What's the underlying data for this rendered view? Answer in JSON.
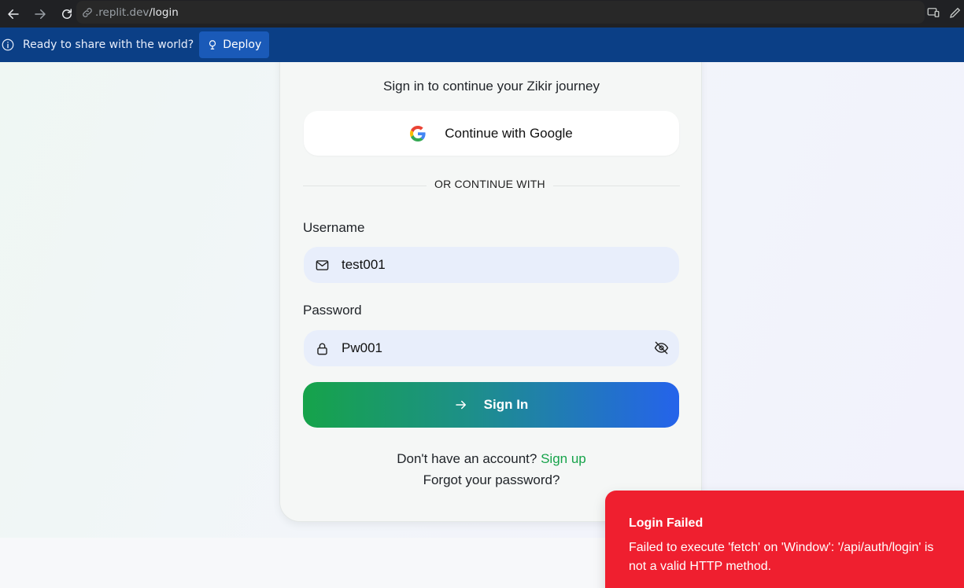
{
  "browser": {
    "url_domain": ".replit.dev",
    "url_path": "/login"
  },
  "banner": {
    "text": "Ready to share with the world?",
    "deploy_label": "Deploy"
  },
  "login": {
    "subtitle": "Sign in to continue your Zikir journey",
    "google_label": "Continue with Google",
    "divider": "OR CONTINUE WITH",
    "username_label": "Username",
    "username_value": "test001",
    "password_label": "Password",
    "password_value": "Pw001",
    "signin_label": "Sign In",
    "no_account": "Don't have an account?",
    "signup_link": "Sign up",
    "forgot": "Forgot your password?"
  },
  "toast": {
    "title": "Login Failed",
    "message": "Failed to execute 'fetch' on 'Window': '/api/auth/login' is not a valid HTTP method."
  },
  "colors": {
    "accent_green": "#16a34a",
    "accent_blue": "#2563eb",
    "toast_red": "#ef1f2f",
    "banner_blue": "#0b3f86"
  }
}
